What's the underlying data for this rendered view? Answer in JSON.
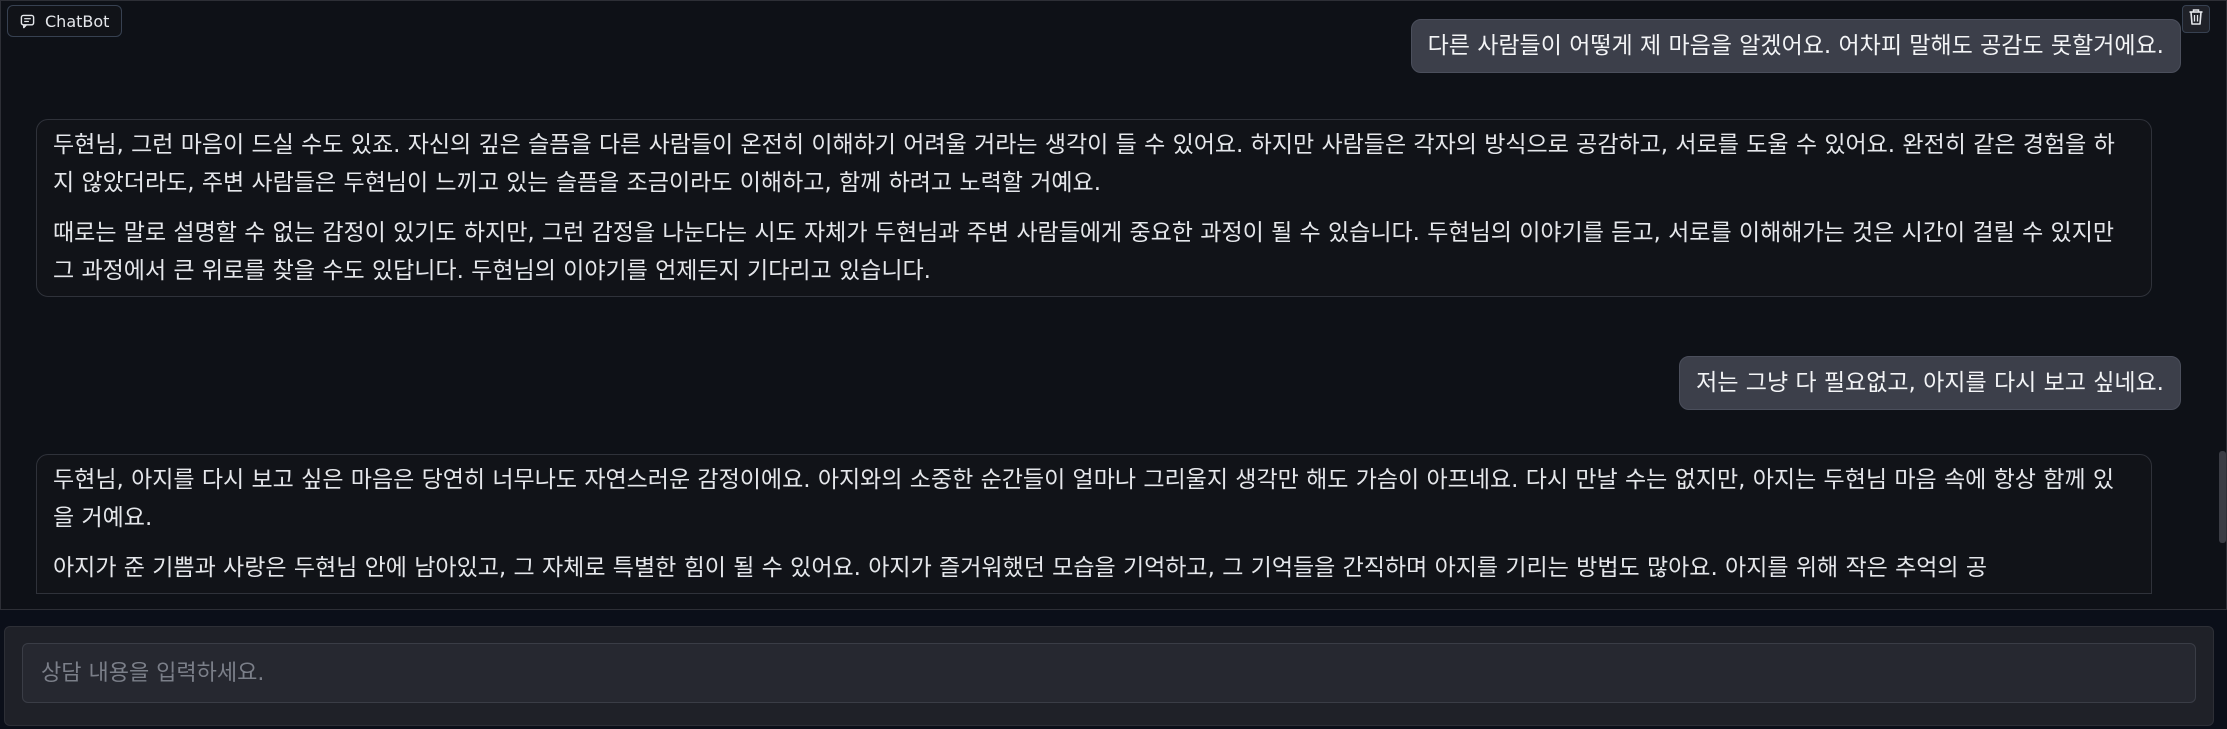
{
  "chatbot": {
    "label": "ChatBot",
    "label_icon": "chat-bubble-icon",
    "clear_icon": "trash-icon"
  },
  "messages": [
    {
      "role": "user",
      "text": "다른 사람들이 어떻게 제 마음을 알겠어요. 어차피 말해도 공감도 못할거에요."
    },
    {
      "role": "bot",
      "paragraphs": [
        "두현님, 그런 마음이 드실 수도 있죠. 자신의 깊은 슬픔을 다른 사람들이 온전히 이해하기 어려울 거라는 생각이 들 수 있어요. 하지만 사람들은 각자의 방식으로 공감하고, 서로를 도울 수 있어요. 완전히 같은 경험을 하지 않았더라도, 주변 사람들은 두현님이 느끼고 있는 슬픔을 조금이라도 이해하고, 함께 하려고 노력할 거예요.",
        "때로는 말로 설명할 수 없는 감정이 있기도 하지만, 그런 감정을 나눈다는 시도 자체가 두현님과 주변 사람들에게 중요한 과정이 될 수 있습니다. 두현님의 이야기를 듣고, 서로를 이해해가는 것은 시간이 걸릴 수 있지만 그 과정에서 큰 위로를 찾을 수도 있답니다. 두현님의 이야기를 언제든지 기다리고 있습니다."
      ]
    },
    {
      "role": "user",
      "text": "저는 그냥 다 필요없고, 아지를 다시 보고 싶네요."
    },
    {
      "role": "bot",
      "paragraphs": [
        "두현님, 아지를 다시 보고 싶은 마음은 당연히 너무나도 자연스러운 감정이에요. 아지와의 소중한 순간들이 얼마나 그리울지 생각만 해도 가슴이 아프네요. 다시 만날 수는 없지만, 아지는 두현님 마음 속에 항상 함께 있을 거예요.",
        "아지가 준 기쁨과 사랑은 두현님 안에 남아있고, 그 자체로 특별한 힘이 될 수 있어요. 아지가 즐거워했던 모습을 기억하고, 그 기억들을 간직하며 아지를 기리는 방법도 많아요. 아지를 위해 작은 추억의 공"
      ]
    }
  ],
  "input": {
    "placeholder": "상담 내용을 입력하세요.",
    "value": ""
  },
  "colors": {
    "background": "#0b0f19",
    "user_bubble": "#3c3f4a",
    "bot_bubble": "#111318",
    "input_panel": "#1f2128"
  }
}
